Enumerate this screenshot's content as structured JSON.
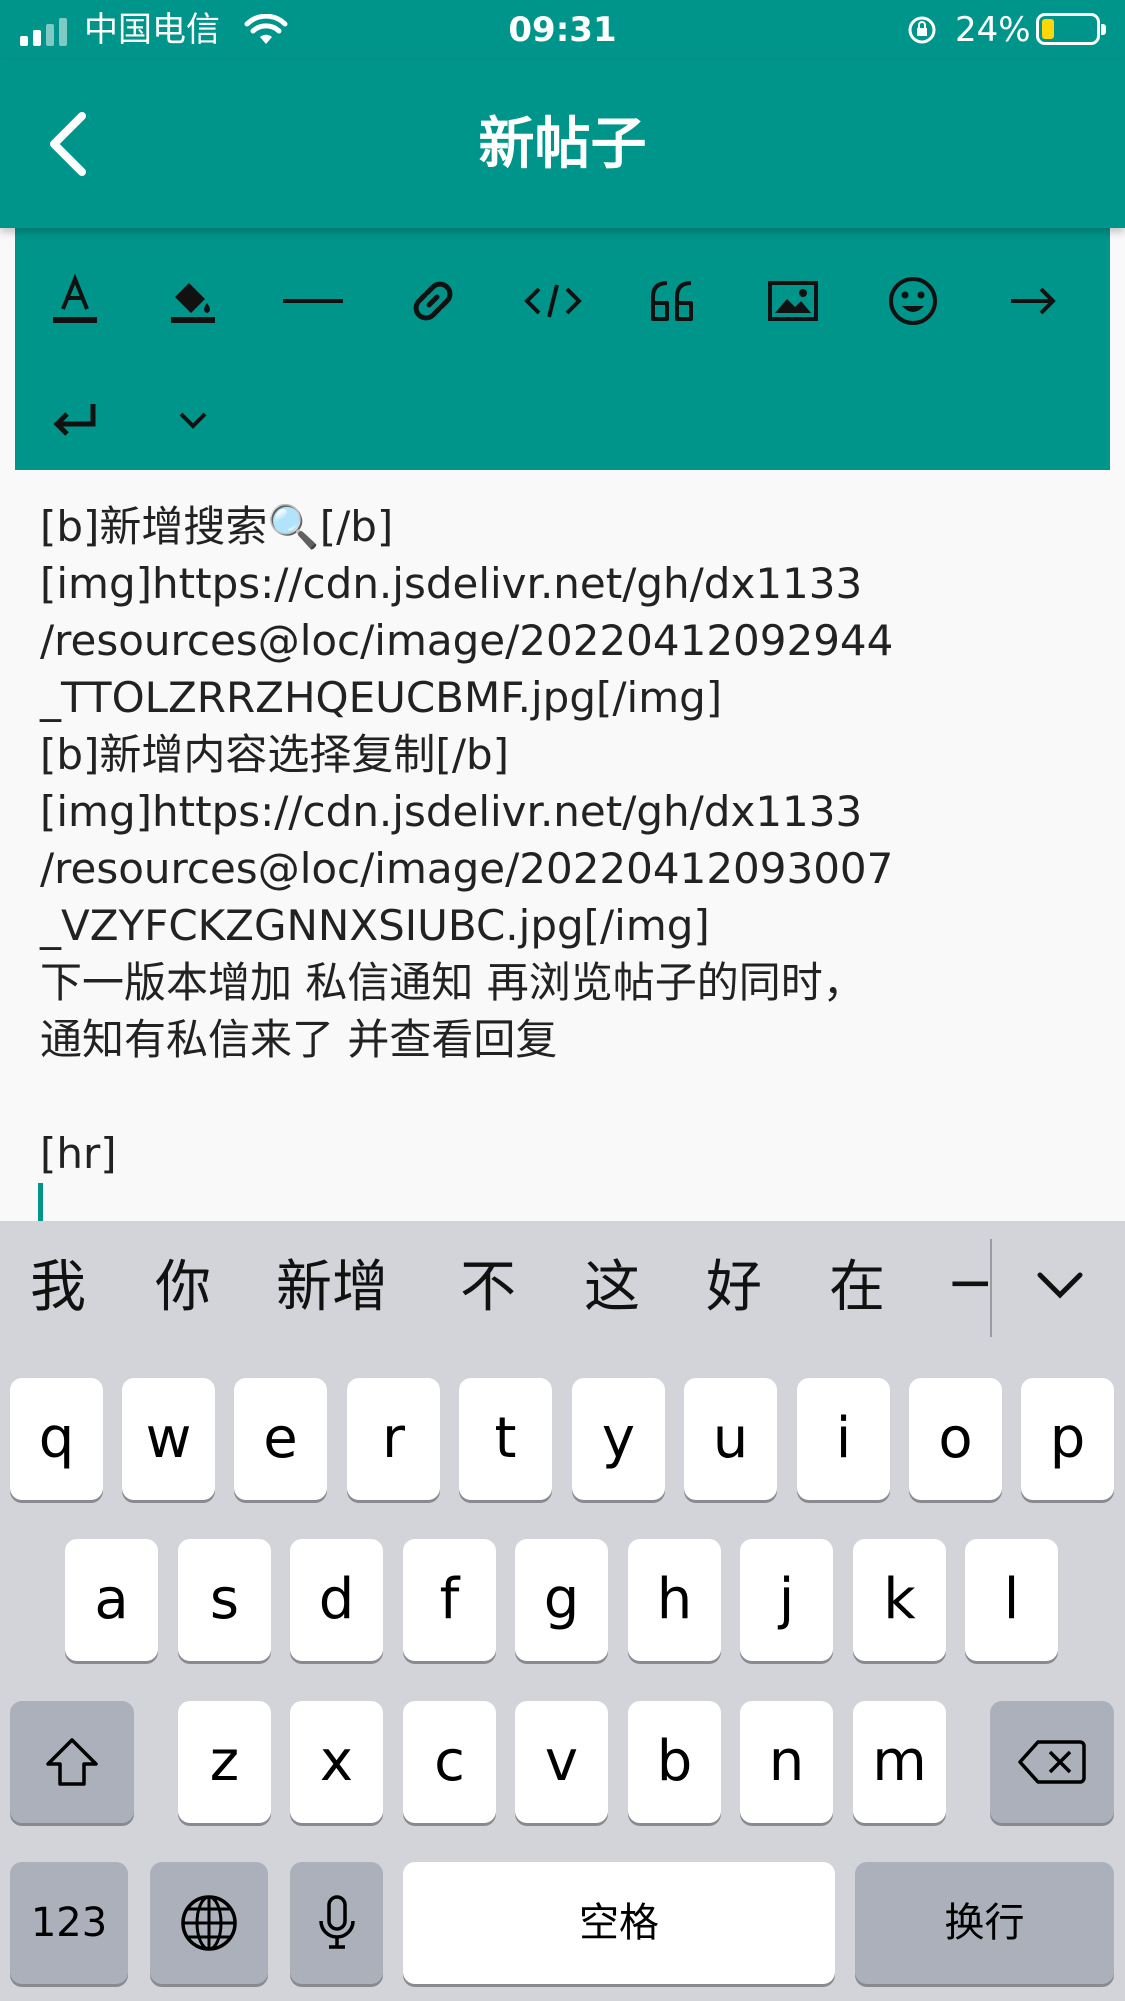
{
  "status_bar": {
    "carrier": "中国电信",
    "time": "09:31",
    "battery_percent": "24%",
    "battery_level": 0.24,
    "icons": [
      "signal-icon",
      "wifi-icon",
      "rotation-lock-icon",
      "battery-icon"
    ]
  },
  "app_bar": {
    "title": "新帖子",
    "back_icon": "chevron-left-icon"
  },
  "toolbar": {
    "buttons": [
      "text-color-icon",
      "highlight-color-icon",
      "horizontal-rule-icon",
      "link-icon",
      "code-icon",
      "quote-icon",
      "image-icon",
      "emoji-icon",
      "indent-icon",
      "line-break-icon",
      "more-chevron-icon"
    ]
  },
  "editor": {
    "content": "[b]新增搜索🔍[/b]\n[img]https://cdn.jsdelivr.net/gh/dx1133\n/resources@loc/image/20220412092944\n_TTOLZRRZHQEUCBMF.jpg[/img]\n[b]新增内容选择复制[/b]\n[img]https://cdn.jsdelivr.net/gh/dx1133\n/resources@loc/image/20220412093007\n_VZYFCKZGNNXSIUBC.jpg[/img]\n下一版本增加 私信通知 再浏览帖子的同时，\n通知有私信来了 并查看回复\n\n[hr]"
  },
  "keyboard": {
    "candidates": [
      "我",
      "你",
      "新增",
      "不",
      "这",
      "好",
      "在",
      "一"
    ],
    "row1": [
      "q",
      "w",
      "e",
      "r",
      "t",
      "y",
      "u",
      "i",
      "o",
      "p"
    ],
    "row2": [
      "a",
      "s",
      "d",
      "f",
      "g",
      "h",
      "j",
      "k",
      "l"
    ],
    "row3": [
      "z",
      "x",
      "c",
      "v",
      "b",
      "n",
      "m"
    ],
    "numbers_label": "123",
    "space_label": "空格",
    "return_label": "换行",
    "colors": {
      "background": "#d2d4da",
      "key": "#ffffff",
      "function_key": "#abb0ba"
    }
  },
  "colors": {
    "accent": "#00958a",
    "editor_bg": "#f9f9fa"
  }
}
